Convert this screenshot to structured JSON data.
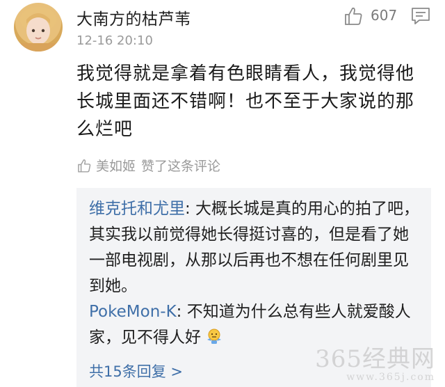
{
  "comment": {
    "username": "大南方的枯芦苇",
    "timestamp": "12-16 20:10",
    "like_count": "607",
    "text": "我觉得就是拿着有色眼睛看人，我觉得他长城里面还不错啊！也不至于大家说的那么烂吧",
    "liked_by": {
      "name": "美如姬",
      "action": "赞了这条评论"
    },
    "icons": {
      "avatar": "avatar",
      "like": "thumbs-up-icon",
      "comment": "comment-bubble-icon"
    }
  },
  "replies": [
    {
      "author": "维克托和尤里",
      "text": ": 大概长城是真的用心的拍了吧，其实我以前觉得她长得挺讨喜的，但是看了她一部电视剧，从那以后再也不想在任何剧里见到她。"
    },
    {
      "author": "PokeMon-K",
      "text": ": 不知道为什么总有些人就爱酸人家，见不得人好",
      "emoji": "shrug-emoji"
    }
  ],
  "more_replies": "共15条回复 >",
  "watermark": {
    "main": "365经典网",
    "sub": "www.365j.com"
  },
  "colors": {
    "link": "#3f6fa8",
    "meta": "#9a9a9a",
    "reply_bg": "#f3f4f6"
  }
}
